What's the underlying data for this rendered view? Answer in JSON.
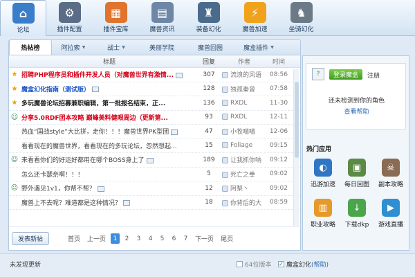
{
  "toolbar": {
    "items": [
      {
        "label": "论坛",
        "icon": "home-icon",
        "color": "#3a7dc9",
        "glyph": "⌂"
      },
      {
        "label": "插件配置",
        "icon": "plugin-config-icon",
        "color": "#5b6d86",
        "glyph": "⚙"
      },
      {
        "label": "插件宝库",
        "icon": "plugin-library-icon",
        "color": "#e0732d",
        "glyph": "▦"
      },
      {
        "label": "魔兽资讯",
        "icon": "news-icon",
        "color": "#6f87a6",
        "glyph": "▤"
      },
      {
        "label": "装备幻化",
        "icon": "transmog-icon",
        "color": "#4a6b8c",
        "glyph": "♜"
      },
      {
        "label": "魔兽加速",
        "icon": "lightning-icon",
        "color": "#f0a21c",
        "glyph": "⚡"
      },
      {
        "label": "坐骑幻化",
        "icon": "mount-icon",
        "color": "#6b7a86",
        "glyph": "♞"
      }
    ]
  },
  "subtabs": [
    {
      "label": "热帖榜",
      "dropdown": false
    },
    {
      "label": "阿拉索",
      "dropdown": true
    },
    {
      "label": "战士",
      "dropdown": true
    },
    {
      "label": "美丽学院",
      "dropdown": false
    },
    {
      "label": "魔兽回图",
      "dropdown": false
    },
    {
      "label": "魔盒插件",
      "dropdown": true
    }
  ],
  "list": {
    "headers": {
      "title": "标题",
      "reply": "回复",
      "author": "作者",
      "time": "时间"
    },
    "rows": [
      {
        "icon": "star",
        "title": "招聘PHP程序员和插件开发人员（对魔兽世界有激情...",
        "color": "#d8001a",
        "bold": true,
        "pic": true,
        "reply": "307",
        "author": "流浪的风语",
        "time": "08:56"
      },
      {
        "icon": "star",
        "title": "魔盒幻化指南（测试版）",
        "color": "#1a56c9",
        "bold": true,
        "pic": true,
        "reply": "128",
        "author": "独孤秦曾",
        "time": "07:58"
      },
      {
        "icon": "star",
        "title": "多玩魔兽论坛招募兼职编辑，第一批报名结束，正...",
        "color": "#222",
        "bold": true,
        "pic": false,
        "reply": "136",
        "author": "RXDL",
        "time": "11-30"
      },
      {
        "icon": "smile",
        "title": "分享5.0RDF团本攻略 巅峰美料健眼周边（更新第...",
        "color": "#d8001a",
        "bold": true,
        "pic": false,
        "reply": "93",
        "author": "RXDL",
        "time": "12-11"
      },
      {
        "icon": "none",
        "title": "热血“国战style”大比拼，走你！！！魔兽世界PK型团",
        "color": "#444",
        "bold": false,
        "pic": true,
        "reply": "47",
        "author": "小牧喵喵",
        "time": "12-06"
      },
      {
        "icon": "none",
        "title": "看看现在的魔兽世界，看看现在的多玩论坛，忽然想起...",
        "color": "#444",
        "bold": false,
        "pic": false,
        "reply": "15",
        "author": "Foliage",
        "time": "09:15"
      },
      {
        "icon": "smile",
        "title": "来看看你们的好运好都用在哪个BOSS身上了",
        "color": "#444",
        "bold": false,
        "pic": true,
        "reply": "189",
        "author": "让我抓你呐",
        "time": "09:12"
      },
      {
        "icon": "none",
        "title": "怎么还卡瑟奈啊！！！",
        "color": "#444",
        "bold": false,
        "pic": false,
        "reply": "5",
        "author": "死亡之拳",
        "time": "09:02"
      },
      {
        "icon": "smile",
        "title": "野外遇见1v1，你帮不帮？",
        "color": "#444",
        "bold": false,
        "pic": true,
        "reply": "12",
        "author": "阿梨丶",
        "time": "09:02"
      },
      {
        "icon": "none",
        "title": "魔兽上不去呢？难道都是这种情况？",
        "color": "#444",
        "bold": false,
        "pic": true,
        "reply": "18",
        "author": "你背后的大",
        "time": "08:59"
      }
    ]
  },
  "footer": {
    "new_post": "发表新帖",
    "first": "首页",
    "prev": "上一页",
    "pages": [
      "1",
      "2",
      "3",
      "4",
      "5",
      "6",
      "7"
    ],
    "current_page": "1",
    "next": "下一页",
    "last": "尾页"
  },
  "side": {
    "login_button": "登录魔盒",
    "register": "注册",
    "no_role": "还未检测到你的角色",
    "help": "查看帮助",
    "hot_title": "热门应用",
    "apps": [
      {
        "label": "迅游加速",
        "icon": "xunyou-icon",
        "color": "#2f77c4",
        "glyph": "◐"
      },
      {
        "label": "每日回图",
        "icon": "daily-picture-icon",
        "color": "#5b8a45",
        "glyph": "▣"
      },
      {
        "label": "副本攻略",
        "icon": "dungeon-guide-icon",
        "color": "#8a6b55",
        "glyph": "☠"
      },
      {
        "label": "职业攻略",
        "icon": "class-guide-icon",
        "color": "#e59a2b",
        "glyph": "▥"
      },
      {
        "label": "下载dkp",
        "icon": "download-dkp-icon",
        "color": "#4ba54a",
        "glyph": "↓"
      },
      {
        "label": "游戏直播",
        "icon": "live-stream-icon",
        "color": "#2f8fd0",
        "glyph": "▶"
      }
    ]
  },
  "status": {
    "text": "未发现更新",
    "check64": "64位版本",
    "checkHuanhua": "魔盒幻化",
    "help": "(帮助)"
  }
}
